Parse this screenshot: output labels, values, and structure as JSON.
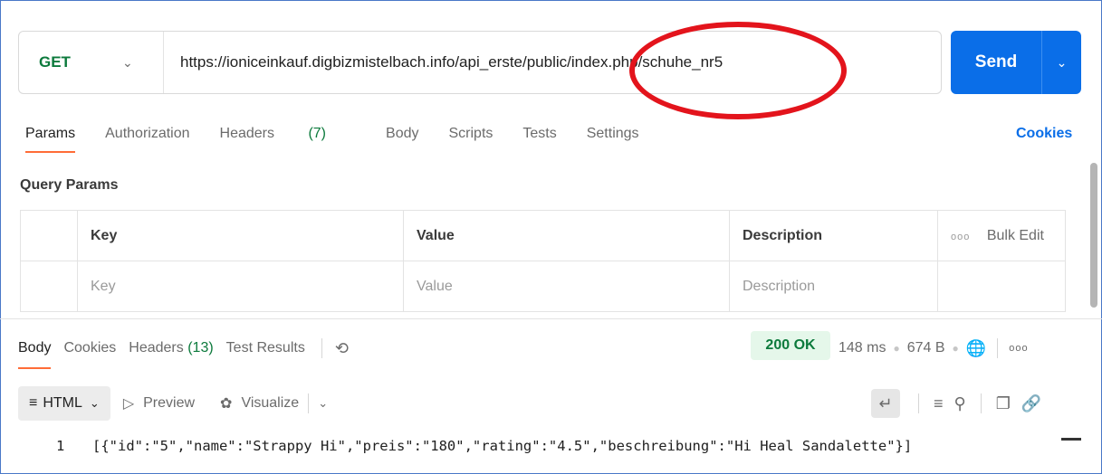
{
  "request": {
    "method": "GET",
    "url": "https://ioniceinkauf.digbizmistelbach.info/api_erste/public/index.php/schuhe_nr5",
    "send_label": "Send"
  },
  "request_tabs": {
    "params": "Params",
    "authorization": "Authorization",
    "headers": "Headers",
    "headers_count": "(7)",
    "body": "Body",
    "scripts": "Scripts",
    "tests": "Tests",
    "settings": "Settings",
    "cookies": "Cookies"
  },
  "query_params": {
    "title": "Query Params",
    "headers": [
      "Key",
      "Value",
      "Description"
    ],
    "bulk_edit": "Bulk Edit",
    "placeholders": [
      "Key",
      "Value",
      "Description"
    ]
  },
  "response_tabs": {
    "body": "Body",
    "cookies": "Cookies",
    "headers": "Headers",
    "headers_count": "(13)",
    "test_results": "Test Results"
  },
  "response_meta": {
    "status": "200 OK",
    "time": "148 ms",
    "size": "674 B"
  },
  "format_bar": {
    "format": "HTML",
    "preview": "Preview",
    "visualize": "Visualize"
  },
  "response_body": {
    "line_number": "1",
    "line": "[{\"id\":\"5\",\"name\":\"Strappy Hi\",\"preis\":\"180\",\"rating\":\"4.5\",\"beschreibung\":\"Hi Heal Sandalette\"}]"
  },
  "colors": {
    "send": "#0a6ee8",
    "method": "#0c7a3c",
    "status_ok": "#0c7a3c",
    "active_tab": "#ff6c37",
    "annotation": "#e3141c"
  }
}
